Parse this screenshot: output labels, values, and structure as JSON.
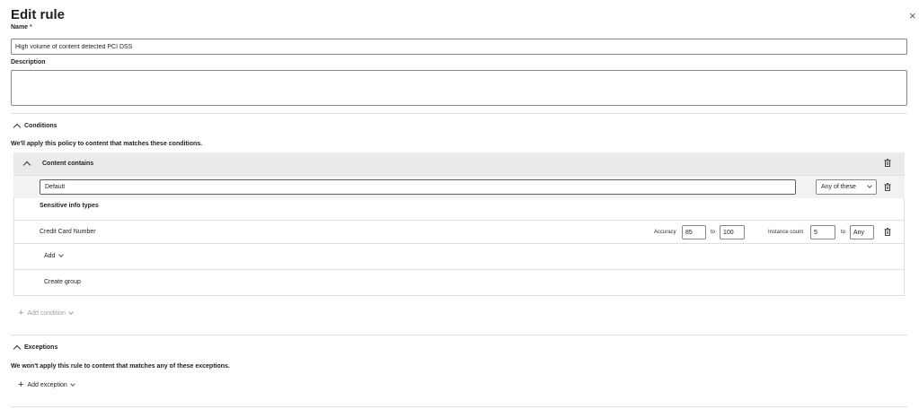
{
  "panel": {
    "title": "Edit rule",
    "close_glyph": "×"
  },
  "name_field": {
    "label": "Name",
    "required_mark": " *",
    "value": "High volume of content detected PCI DSS"
  },
  "description_field": {
    "label": "Description",
    "value": ""
  },
  "conditions": {
    "heading": "Conditions",
    "note": "We'll apply this policy to content that matches these conditions.",
    "content_contains": {
      "heading": "Content contains",
      "group_name_value": "Default",
      "match_dropdown": "Any of these",
      "sensitive_info_heading": "Sensitive info types",
      "items": [
        {
          "name": "Credit Card Number",
          "accuracy_label": "Accuracy",
          "accuracy_min": "85",
          "accuracy_to": "to",
          "accuracy_max": "100",
          "instance_label": "Instance count",
          "instance_min": "5",
          "instance_to": "to",
          "instance_max": "Any"
        }
      ],
      "add_label": "Add",
      "create_group_label": "Create group"
    },
    "add_condition_label": "Add condition"
  },
  "exceptions": {
    "heading": "Exceptions",
    "note": "We won't apply this rule to content that matches any of these exceptions.",
    "add_exception_label": "Add exception"
  },
  "icons": [
    "close-icon",
    "chevron-up-icon",
    "chevron-down-icon",
    "trash-icon",
    "plus-icon"
  ]
}
